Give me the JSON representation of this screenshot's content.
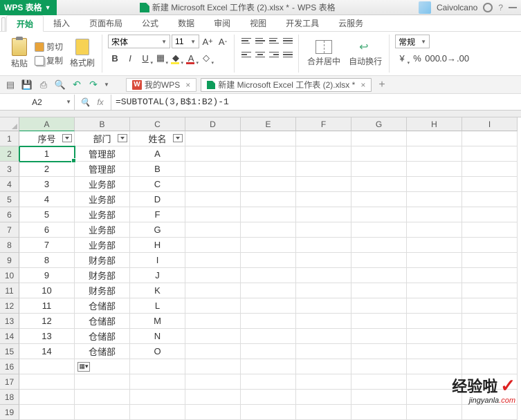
{
  "app": {
    "name": "WPS 表格",
    "title_file": "新建 Microsoft Excel 工作表 (2).xlsx *",
    "title_suffix": "WPS 表格",
    "user": "Caivolcano"
  },
  "menu": {
    "items": [
      "开始",
      "插入",
      "页面布局",
      "公式",
      "数据",
      "审阅",
      "视图",
      "开发工具",
      "云服务"
    ],
    "active": 0
  },
  "ribbon": {
    "paste": "粘贴",
    "cut": "剪切",
    "copy": "复制",
    "formatpainter": "格式刷",
    "font_name": "宋体",
    "font_size": "11",
    "merge": "合并居中",
    "wrap": "自动换行",
    "numfmt": "常规"
  },
  "qa": {
    "mywps": "我的WPS",
    "doc": "新建 Microsoft Excel 工作表 (2).xlsx *"
  },
  "formula": {
    "cellref": "A2",
    "fx": "fx",
    "value": "=SUBTOTAL(3,B$1:B2)-1"
  },
  "columns": [
    "A",
    "B",
    "C",
    "D",
    "E",
    "F",
    "G",
    "H",
    "I"
  ],
  "headers": {
    "A": "序号",
    "B": "部门",
    "C": "姓名"
  },
  "rows": [
    {
      "n": "1",
      "a": "1",
      "b": "管理部",
      "c": "A"
    },
    {
      "n": "2",
      "a": "2",
      "b": "管理部",
      "c": "B"
    },
    {
      "n": "3",
      "a": "3",
      "b": "业务部",
      "c": "C"
    },
    {
      "n": "4",
      "a": "4",
      "b": "业务部",
      "c": "D"
    },
    {
      "n": "5",
      "a": "5",
      "b": "业务部",
      "c": "F"
    },
    {
      "n": "6",
      "a": "6",
      "b": "业务部",
      "c": "G"
    },
    {
      "n": "7",
      "a": "7",
      "b": "业务部",
      "c": "H"
    },
    {
      "n": "8",
      "a": "8",
      "b": "财务部",
      "c": "I"
    },
    {
      "n": "9",
      "a": "9",
      "b": "财务部",
      "c": "J"
    },
    {
      "n": "10",
      "a": "10",
      "b": "财务部",
      "c": "K"
    },
    {
      "n": "11",
      "a": "11",
      "b": "仓储部",
      "c": "L"
    },
    {
      "n": "12",
      "a": "12",
      "b": "仓储部",
      "c": "M"
    },
    {
      "n": "13",
      "a": "13",
      "b": "仓储部",
      "c": "N"
    },
    {
      "n": "14",
      "a": "14",
      "b": "仓储部",
      "c": "O"
    }
  ],
  "watermark": {
    "big": "经验啦",
    "small1": "jingyanla",
    "small2": ".com"
  }
}
